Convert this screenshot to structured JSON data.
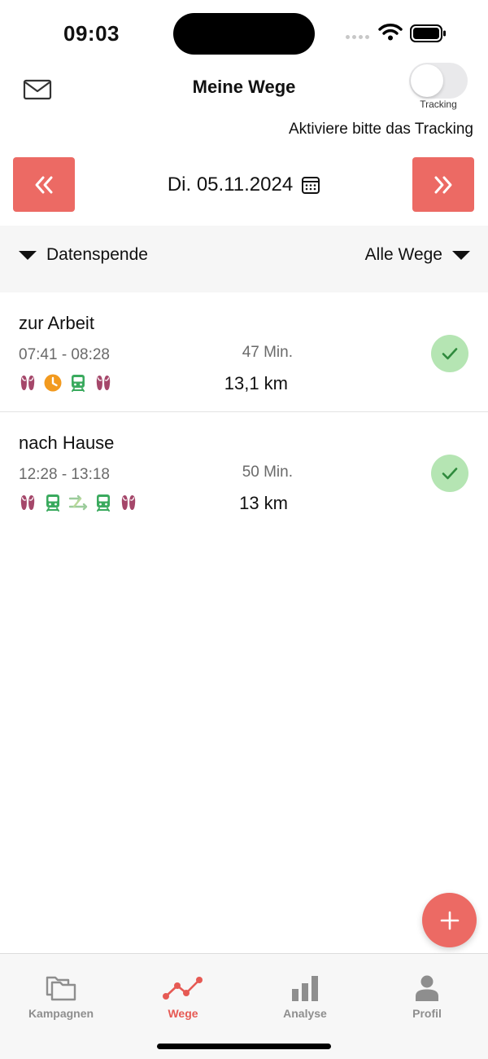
{
  "status_bar": {
    "time": "09:03"
  },
  "header": {
    "title": "Meine Wege",
    "tracking_toggle_label": "Tracking",
    "tracking_hint": "Aktiviere bitte das Tracking"
  },
  "date_nav": {
    "date": "Di. 05.11.2024"
  },
  "filters": {
    "left_label": "Datenspende",
    "right_label": "Alle Wege"
  },
  "trips": [
    {
      "title": "zur Arbeit",
      "time_range": "07:41 - 08:28",
      "duration": "47 Min.",
      "distance": "13,1 km",
      "modes": [
        "footprints-icon",
        "waiting-clock-icon",
        "train-icon",
        "footprints-icon"
      ],
      "status": "confirmed"
    },
    {
      "title": "nach Hause",
      "time_range": "12:28 - 13:18",
      "duration": "50 Min.",
      "distance": "13 km",
      "modes": [
        "footprints-icon",
        "train-icon",
        "transfer-icon",
        "train-icon",
        "footprints-icon"
      ],
      "status": "confirmed"
    }
  ],
  "tab_bar": {
    "tabs": [
      {
        "label": "Kampagnen",
        "icon": "folders-icon"
      },
      {
        "label": "Wege",
        "icon": "route-icon",
        "active": true
      },
      {
        "label": "Analyse",
        "icon": "bar-chart-icon"
      },
      {
        "label": "Profil",
        "icon": "person-icon"
      }
    ]
  },
  "colors": {
    "accent": "#ec6a64",
    "footprints": "#a5476a",
    "train": "#3aaa5e",
    "waiting": "#f29a1f",
    "check_bg": "#b5e5b3",
    "check_mark": "#2f8a3d",
    "tab_inactive": "#8e8e8e"
  }
}
